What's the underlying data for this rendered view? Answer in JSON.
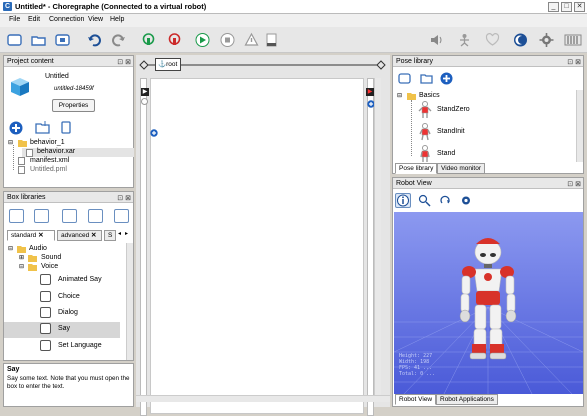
{
  "window": {
    "title": "Untitled* - Choregraphe (Connected to a virtual robot)",
    "controls": [
      "_",
      "□",
      "✕"
    ]
  },
  "menu": [
    "File",
    "Edit",
    "Connection",
    "View",
    "Help"
  ],
  "toolbar": {
    "left_icons": [
      "new-project-icon",
      "open-project-icon",
      "save-project-icon",
      "undo-icon",
      "redo-icon",
      "connect-icon",
      "disconnect-icon",
      "play-icon",
      "stop-icon",
      "debug-icon",
      "robot-status-icon"
    ],
    "right_icons": [
      "volume-icon",
      "autonomous-life-icon",
      "wake-up-icon",
      "sleep-icon",
      "settings-icon",
      "battery-icon"
    ]
  },
  "project_content": {
    "title": "Project content",
    "project_name": "Untitled",
    "project_id": "untitled-18459f",
    "properties_label": "Properties",
    "tree": [
      {
        "label": "behavior_1",
        "type": "folder"
      },
      {
        "label": "behavior.xar",
        "type": "file",
        "selected": true
      },
      {
        "label": "manifest.xml",
        "type": "file"
      },
      {
        "label": "Untitled.pml",
        "type": "file"
      }
    ]
  },
  "box_libraries": {
    "title": "Box libraries",
    "tabs": [
      "standard",
      "advanced",
      "S"
    ],
    "folders": [
      "Audio",
      "Sound",
      "Voice"
    ],
    "boxes": [
      "Animated Say",
      "Choice",
      "Dialog",
      "Say",
      "Set Language"
    ],
    "selected_box": "Say"
  },
  "description": {
    "title": "Say",
    "text": "Say some text. Note that you must open the box to enter the text."
  },
  "flow": {
    "root_label": "root"
  },
  "pose_library": {
    "title": "Pose library",
    "folder": "Basics",
    "poses": [
      "StandZero",
      "StandInit",
      "Stand"
    ],
    "tabs": [
      "Pose library",
      "Video monitor"
    ]
  },
  "robot_view": {
    "title": "Robot View",
    "tabs": [
      "Robot View",
      "Robot Applications"
    ],
    "stats": [
      "Height: 227",
      "Width: 198",
      "FPS: 41 ...",
      "Total: 0 ..."
    ],
    "colors": {
      "floor": "#4a5ad8",
      "accent": "#d8322a",
      "robot_white": "#f2f2f2"
    }
  }
}
